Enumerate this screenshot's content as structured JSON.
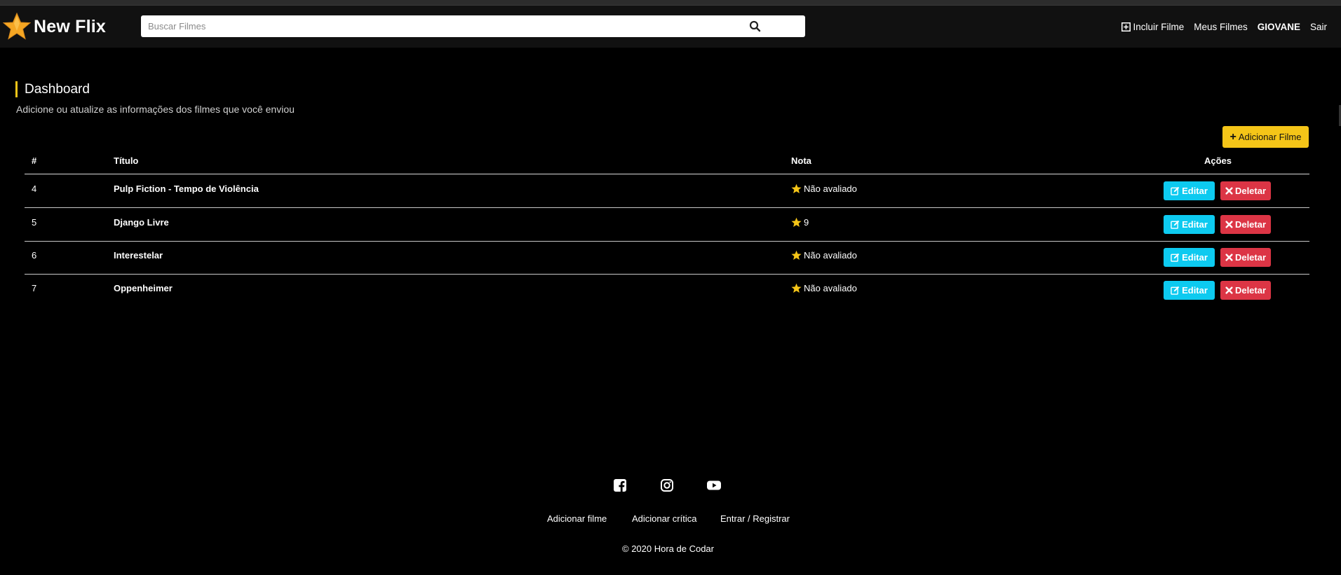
{
  "navbar": {
    "brand": "New Flix",
    "search_placeholder": "Buscar Filmes",
    "links": {
      "add_movie": "Incluir Filme",
      "my_movies": "Meus Filmes",
      "user": "GIOVANE",
      "logout": "Sair"
    }
  },
  "page": {
    "title": "Dashboard",
    "subtitle": "Adicione ou atualize as informações dos filmes que você enviou",
    "add_button": "Adicionar Filme"
  },
  "table": {
    "headers": {
      "id": "#",
      "title": "Título",
      "rating": "Nota",
      "actions": "Ações"
    },
    "rows": [
      {
        "id": "4",
        "title": "Pulp Fiction - Tempo de Violência",
        "rating": "Não avaliado"
      },
      {
        "id": "5",
        "title": "Django Livre",
        "rating": "9"
      },
      {
        "id": "6",
        "title": "Interestelar",
        "rating": "Não avaliado"
      },
      {
        "id": "7",
        "title": "Oppenheimer",
        "rating": "Não avaliado"
      }
    ],
    "edit_label": "Editar",
    "delete_label": "Deletar"
  },
  "footer": {
    "social": [
      "facebook-icon",
      "instagram-icon",
      "youtube-icon"
    ],
    "links": {
      "add_movie": "Adicionar filme",
      "add_review": "Adicionar crítica",
      "login": "Entrar / Registrar"
    },
    "copyright": "© 2020 Hora de Codar"
  },
  "colors": {
    "accent": "#f5c518",
    "edit": "#0dcaf0",
    "delete": "#dc3545",
    "navbar": "#111111",
    "background": "#000000"
  }
}
